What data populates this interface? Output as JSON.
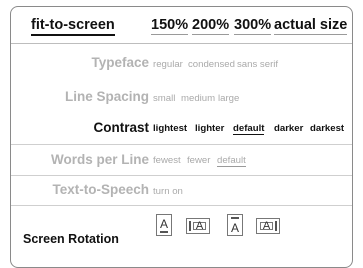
{
  "zoom": {
    "options": [
      "fit-to-screen",
      "150%",
      "200%",
      "300%",
      "actual size"
    ],
    "selected": "fit-to-screen"
  },
  "settings": {
    "typeface": {
      "label": "Typeface",
      "options": [
        "regular",
        "condensed",
        "sans serif"
      ]
    },
    "line_spacing": {
      "label": "Line Spacing",
      "options": [
        "small",
        "medium",
        "large"
      ]
    },
    "contrast": {
      "label": "Contrast",
      "options": [
        "lightest",
        "lighter",
        "default",
        "darker",
        "darkest"
      ],
      "selected": "default"
    },
    "words_per_line": {
      "label": "Words per Line",
      "options": [
        "fewest",
        "fewer",
        "default"
      ],
      "selected": "default"
    },
    "text_to_speech": {
      "label": "Text-to-Speech",
      "options": [
        "turn on"
      ]
    },
    "screen_rotation": {
      "label": "Screen Rotation",
      "icons": [
        {
          "glyph": "A",
          "name": "portrait-icon"
        },
        {
          "glyph": "A",
          "name": "landscape-left-icon"
        },
        {
          "glyph": "A",
          "name": "portrait-upside-down-icon"
        },
        {
          "glyph": "A",
          "name": "landscape-right-icon"
        }
      ]
    }
  }
}
